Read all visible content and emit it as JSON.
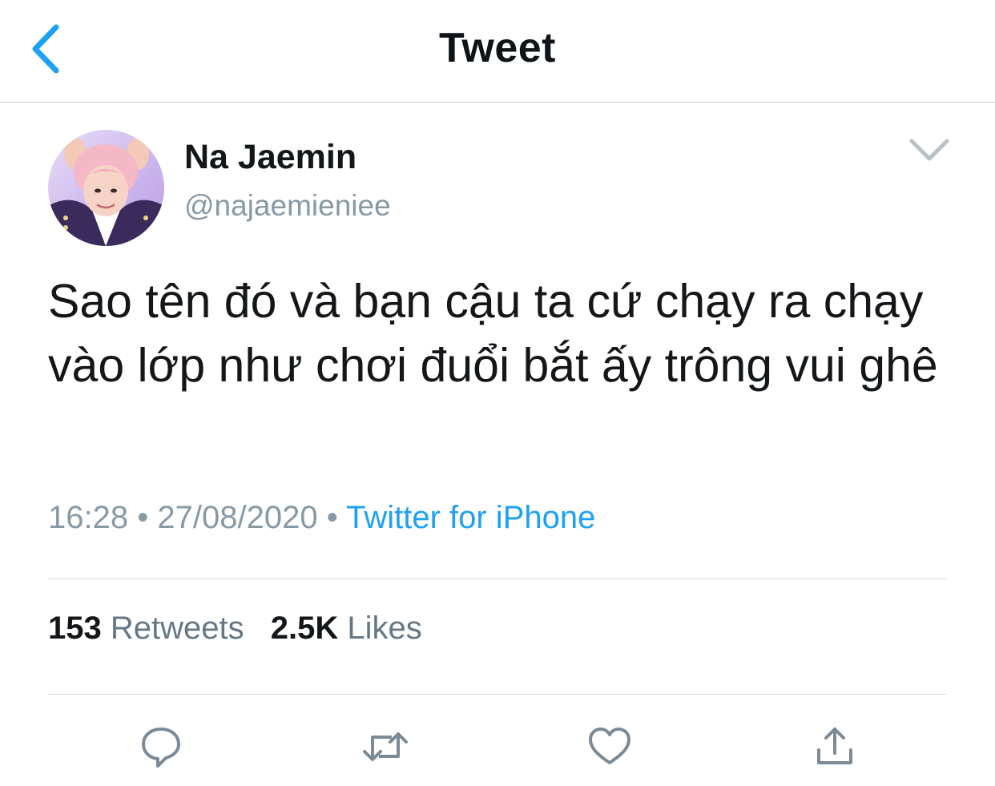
{
  "nav": {
    "title": "Tweet"
  },
  "author": {
    "display_name": "Na Jaemin",
    "handle": "@najaemieniee"
  },
  "tweet": {
    "text": "Sao tên đó và bạn cậu ta cứ chạy ra chạy vào lớp như chơi đuổi bắt ấy trông vui ghê",
    "time": "16:28",
    "date": "27/08/2020",
    "separator": "•",
    "source": "Twitter for iPhone"
  },
  "stats": {
    "retweets_count": "153",
    "retweets_label": "Retweets",
    "likes_count": "2.5K",
    "likes_label": "Likes"
  },
  "colors": {
    "accent": "#1da1f2",
    "secondary_text": "#8899a6",
    "icon": "#7c8a97"
  },
  "icons": {
    "back": "chevron-left-icon",
    "more": "chevron-down-icon",
    "reply": "reply-icon",
    "retweet": "retweet-icon",
    "like": "heart-icon",
    "share": "share-icon"
  }
}
